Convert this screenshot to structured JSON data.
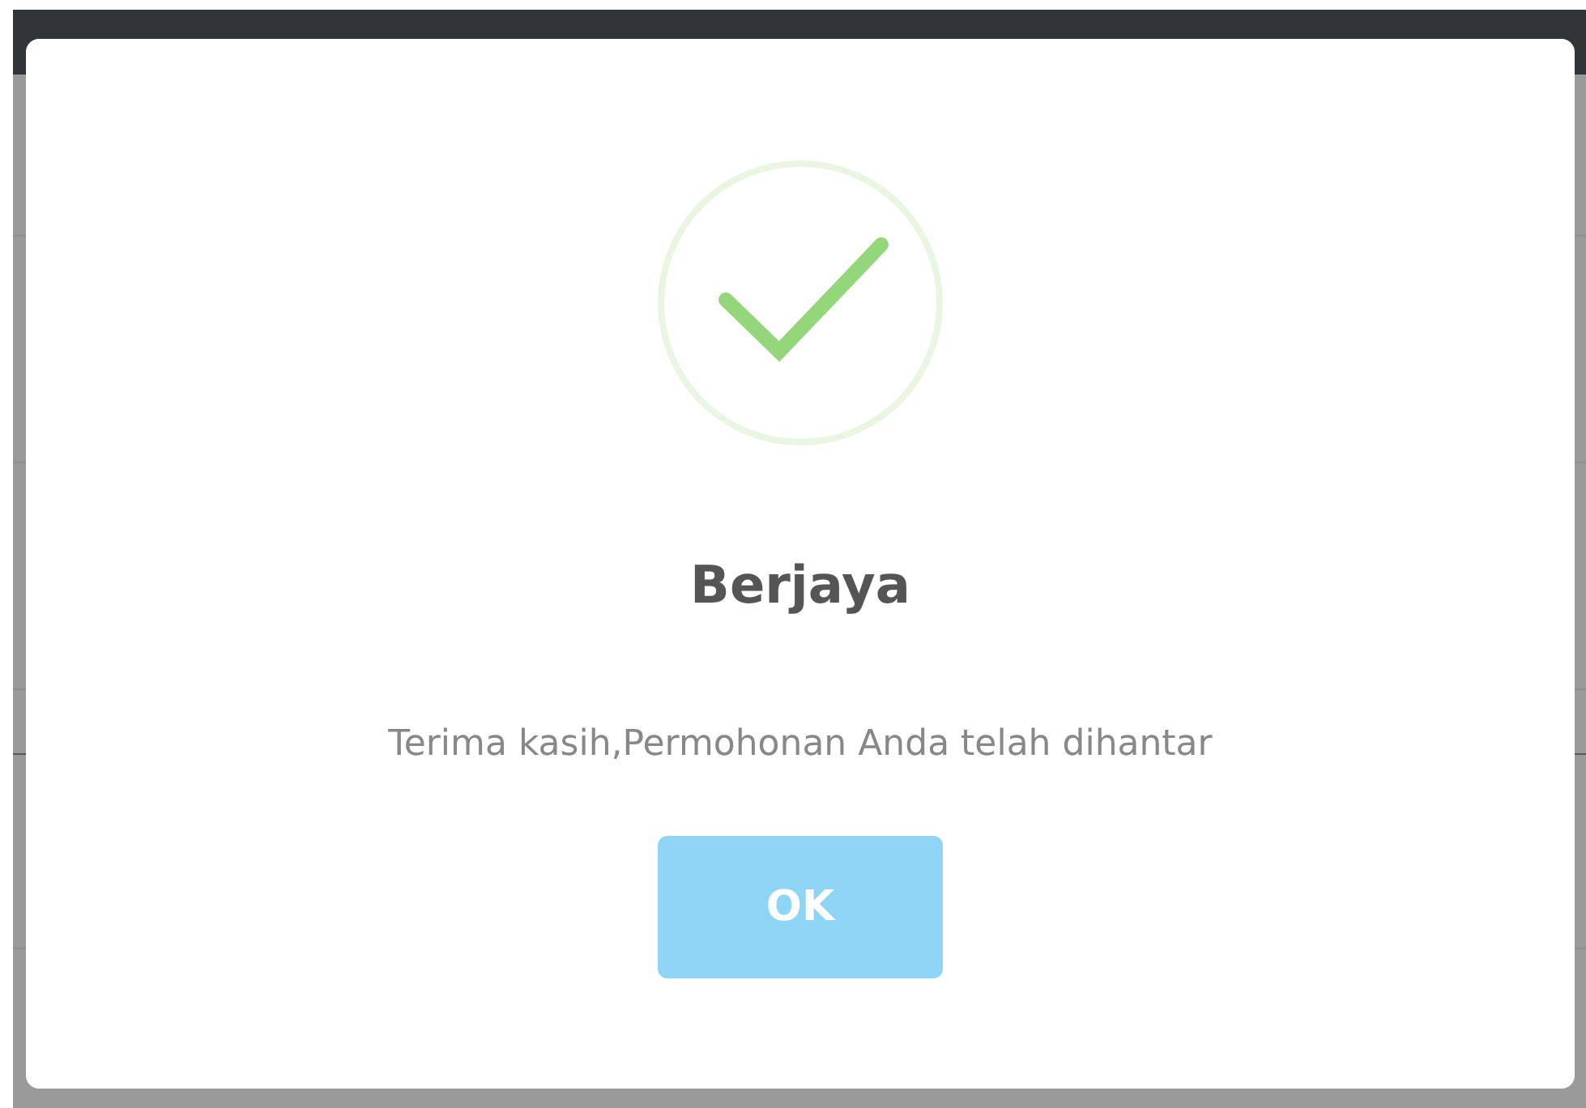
{
  "dialog": {
    "title": "Berjaya",
    "message": "Terima kasih,Permohonan Anda telah dihantar",
    "button": "OK"
  }
}
